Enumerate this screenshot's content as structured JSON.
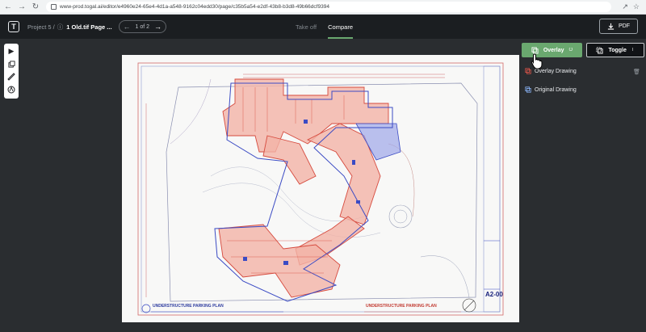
{
  "browser": {
    "url": "www-prod.togal.ai/editor/e4960e24-65e4-4d1a-a548-9162c04edd30/page/c35b5a54-e2df-43b8-b3d8-49b66dcf9394"
  },
  "header": {
    "project_label": "Project 5 /",
    "file_name": "1 Old.tif Page ...",
    "pager_text": "1 of 2",
    "tabs": [
      {
        "label": "Take off"
      },
      {
        "label": "Compare"
      }
    ],
    "pdf_label": "PDF"
  },
  "panel": {
    "overlay_label": "Overlay",
    "overlay_shortcut": "O",
    "toggle_label": "Toggle",
    "toggle_shortcut": "T",
    "layers": [
      {
        "label": "Overlay Drawing"
      },
      {
        "label": "Original Drawing"
      }
    ]
  },
  "drawing": {
    "title_block_sheet": "A2-00",
    "plan_title": "UNDERSTRUCTURE PARKING PLAN",
    "title_block_label": "UNDERSTRUCTURE PARKING PLAN"
  },
  "colors": {
    "accent_green": "#6aa86f",
    "header_bg": "#1b1e21",
    "overlay_red": "#e0554a",
    "original_blue": "#3b4bc4"
  }
}
